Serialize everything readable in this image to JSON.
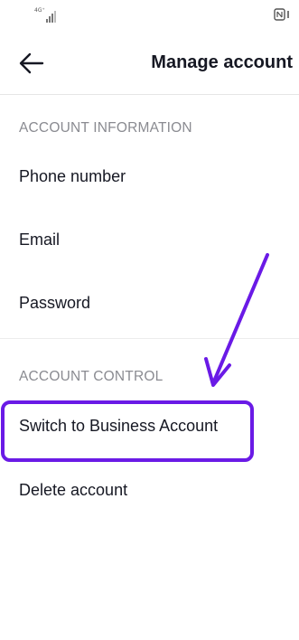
{
  "status_bar": {
    "network_type": "4G⁺",
    "network_sub": "+↑↓",
    "signal_icon": "signal-bars-icon",
    "nfc_icon": "nfc-icon"
  },
  "header": {
    "back_icon": "back-arrow-icon",
    "title": "Manage account"
  },
  "sections": [
    {
      "label": "ACCOUNT INFORMATION",
      "items": [
        "Phone number",
        "Email",
        "Password"
      ]
    },
    {
      "label": "ACCOUNT CONTROL",
      "items": [
        "Switch to Business Account",
        "Delete account"
      ]
    }
  ],
  "annotation": {
    "highlight_color": "#6a1ae6",
    "arrow_icon": "annotation-arrow-icon"
  }
}
